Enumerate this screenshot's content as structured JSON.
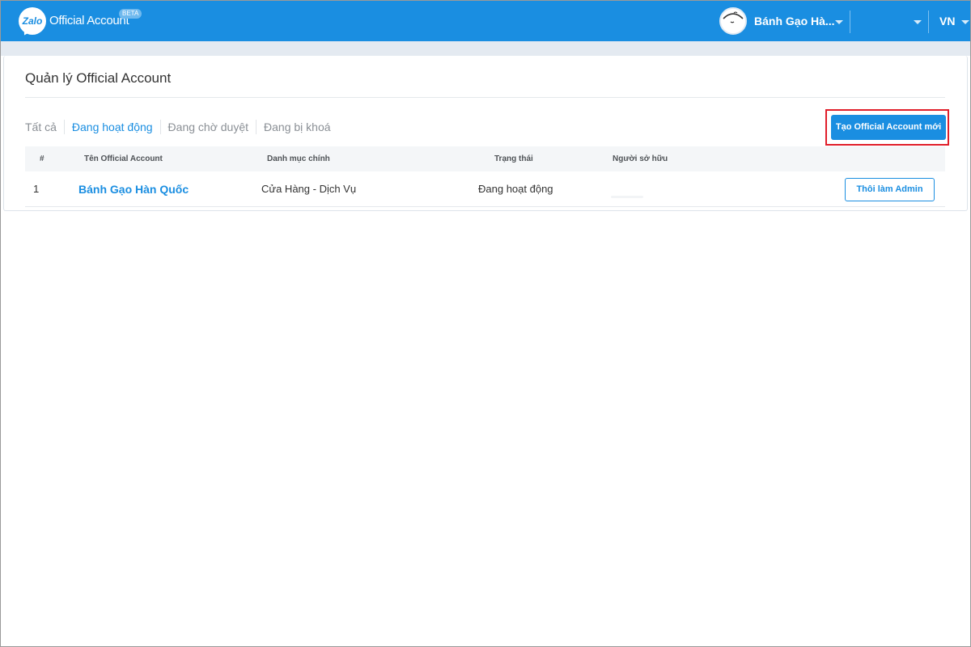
{
  "header": {
    "logo_text": "Zalo",
    "brand": "Official Account",
    "beta_badge": "BETA",
    "account_name": "Bánh Gạo Hà...",
    "language": "VN",
    "colors": {
      "primary": "#1a8ee1",
      "highlight": "#e01e2a"
    }
  },
  "page": {
    "title": "Quản lý Official Account",
    "tabs": [
      {
        "label": "Tất cả",
        "active": false
      },
      {
        "label": "Đang hoạt động",
        "active": true
      },
      {
        "label": "Đang chờ duyệt",
        "active": false
      },
      {
        "label": "Đang bị khoá",
        "active": false
      }
    ],
    "create_button": "Tạo Official Account mới"
  },
  "table": {
    "columns": [
      "#",
      "Tên Official Account",
      "Danh mục chính",
      "Trạng thái",
      "Người sở hữu"
    ],
    "rows": [
      {
        "index": "1",
        "name": "Bánh Gạo Hàn Quốc",
        "category": "Cửa Hàng - Dịch Vụ",
        "status": "Đang hoạt động",
        "owner": "",
        "action": "Thôi làm Admin"
      }
    ]
  }
}
